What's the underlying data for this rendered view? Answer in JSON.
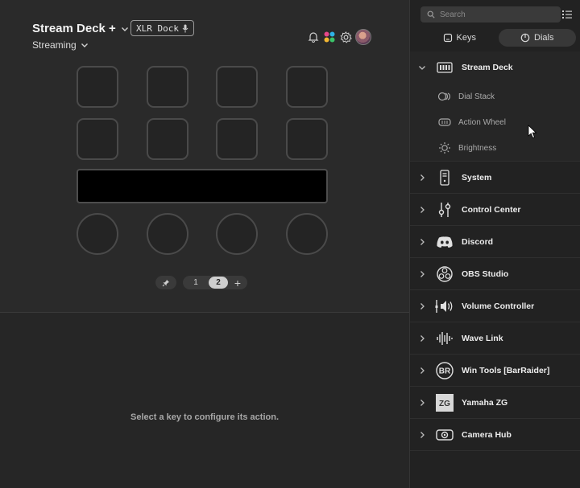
{
  "header": {
    "device_name": "Stream Deck +",
    "dock_label": "XLR Dock",
    "profile_name": "Streaming"
  },
  "pager": {
    "pages": [
      "1",
      "2"
    ],
    "active_page": "2",
    "add_label": "+"
  },
  "editor": {
    "hint": "Select a key to configure its action."
  },
  "sidebar": {
    "search_placeholder": "Search",
    "tabs": [
      {
        "label": "Keys",
        "icon": "key-icon",
        "active": false
      },
      {
        "label": "Dials",
        "icon": "dial-icon",
        "active": true
      }
    ],
    "categories": [
      {
        "label": "Stream Deck",
        "icon": "stream-deck-icon",
        "expanded": true,
        "items": [
          {
            "label": "Dial Stack",
            "icon": "dial-stack-icon"
          },
          {
            "label": "Action Wheel",
            "icon": "action-wheel-icon"
          },
          {
            "label": "Brightness",
            "icon": "brightness-icon"
          }
        ]
      },
      {
        "label": "System",
        "icon": "system-icon"
      },
      {
        "label": "Control Center",
        "icon": "control-center-icon"
      },
      {
        "label": "Discord",
        "icon": "discord-icon"
      },
      {
        "label": "OBS Studio",
        "icon": "obs-icon"
      },
      {
        "label": "Volume Controller",
        "icon": "volume-icon"
      },
      {
        "label": "Wave Link",
        "icon": "wave-link-icon"
      },
      {
        "label": "Win Tools [BarRaider]",
        "icon": "barraider-icon",
        "icon_text": "BR"
      },
      {
        "label": "Yamaha ZG",
        "icon": "yamaha-zg-icon",
        "icon_text": "ZG"
      },
      {
        "label": "Camera Hub",
        "icon": "camera-hub-icon"
      }
    ]
  },
  "colors": {
    "canvas_bg": "#2a2a2a",
    "sidebar_bg": "#222222",
    "key_border": "#4a4a4a",
    "touchstrip": "#000000"
  }
}
